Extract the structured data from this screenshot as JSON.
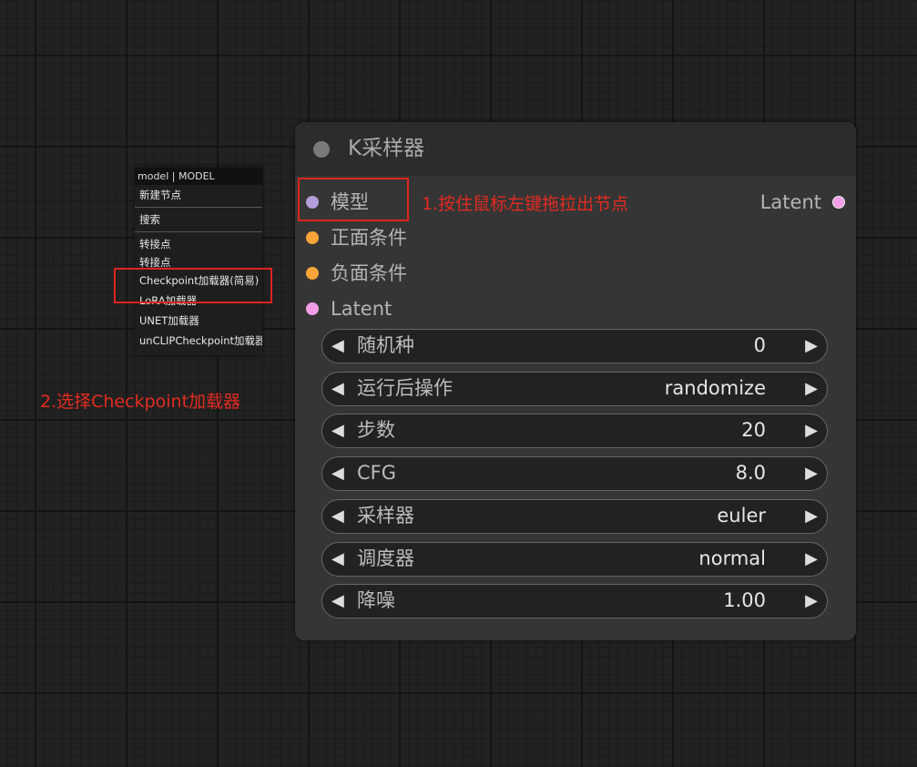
{
  "context_menu": {
    "title": "model | MODEL",
    "items": {
      "new_node": "新建节点",
      "search": "搜索",
      "reroute1": "转接点",
      "reroute2": "转接点",
      "checkpoint_simple": "Checkpoint加载器(简易)",
      "lora": "LoRA加载器",
      "unet": "UNET加载器",
      "unclip": "unCLIPCheckpoint加载器"
    }
  },
  "node": {
    "title": "K采样器",
    "inputs": {
      "model": "模型",
      "positive": "正面条件",
      "negative": "负面条件",
      "latent": "Latent"
    },
    "output": "Latent",
    "widgets": {
      "seed": {
        "label": "随机种",
        "value": "0"
      },
      "control_after": {
        "label": "运行后操作",
        "value": "randomize"
      },
      "steps": {
        "label": "步数",
        "value": "20"
      },
      "cfg": {
        "label": "CFG",
        "value": "8.0"
      },
      "sampler": {
        "label": "采样器",
        "value": "euler"
      },
      "scheduler": {
        "label": "调度器",
        "value": "normal"
      },
      "denoise": {
        "label": "降噪",
        "value": "1.00"
      }
    },
    "arrow_left": "◀",
    "arrow_right": "▶"
  },
  "annotations": {
    "step1": "1.按住鼠标左键拖拉出节点",
    "step2": "2.选择Checkpoint加载器"
  },
  "colors": {
    "model_pin": "#b39ddb",
    "conditioning_pin": "#f7a53a",
    "latent_pin": "#f39de7",
    "annotation_red": "#e0231e"
  }
}
